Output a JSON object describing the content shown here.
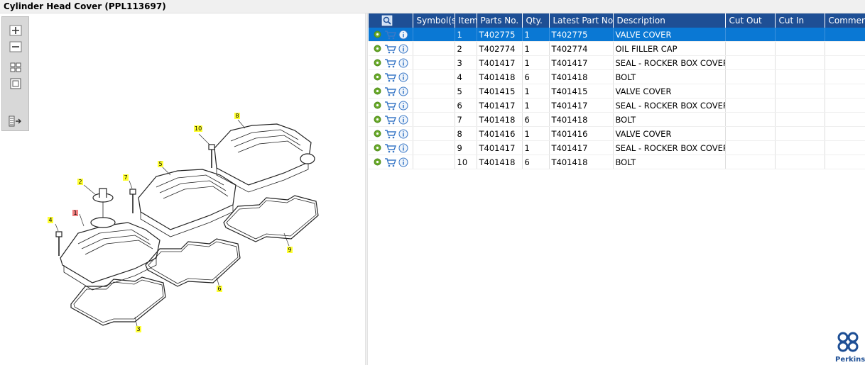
{
  "title": "Cylinder Head Cover (PPL113697)",
  "toolbar": {
    "zoom_in": "zoom-in-icon",
    "zoom_out": "zoom-out-icon",
    "fit": "fit-page-icon",
    "actual": "actual-size-icon",
    "layout": "toggle-layout-icon"
  },
  "callouts": [
    "1",
    "2",
    "3",
    "4",
    "5",
    "6",
    "7",
    "8",
    "9",
    "10"
  ],
  "grid": {
    "columns": [
      "Symbol(s)",
      "Item",
      "Parts No.",
      "Qty.",
      "Latest Part No.",
      "Description",
      "Cut Out",
      "Cut In",
      "Comment"
    ],
    "rows": [
      {
        "item": "1",
        "part": "T402775",
        "qty": "1",
        "latest": "T402775",
        "desc": "VALVE COVER"
      },
      {
        "item": "2",
        "part": "T402774",
        "qty": "1",
        "latest": "T402774",
        "desc": "OIL FILLER CAP"
      },
      {
        "item": "3",
        "part": "T401417",
        "qty": "1",
        "latest": "T401417",
        "desc": "SEAL - ROCKER BOX COVER"
      },
      {
        "item": "4",
        "part": "T401418",
        "qty": "6",
        "latest": "T401418",
        "desc": "BOLT"
      },
      {
        "item": "5",
        "part": "T401415",
        "qty": "1",
        "latest": "T401415",
        "desc": "VALVE COVER"
      },
      {
        "item": "6",
        "part": "T401417",
        "qty": "1",
        "latest": "T401417",
        "desc": "SEAL - ROCKER BOX COVER"
      },
      {
        "item": "7",
        "part": "T401418",
        "qty": "6",
        "latest": "T401418",
        "desc": "BOLT"
      },
      {
        "item": "8",
        "part": "T401416",
        "qty": "1",
        "latest": "T401416",
        "desc": "VALVE COVER"
      },
      {
        "item": "9",
        "part": "T401417",
        "qty": "1",
        "latest": "T401417",
        "desc": "SEAL - ROCKER BOX COVER"
      },
      {
        "item": "10",
        "part": "T401418",
        "qty": "6",
        "latest": "T401418",
        "desc": "BOLT"
      }
    ]
  },
  "brand": {
    "name": "Perkins",
    "color": "#1e4f95"
  },
  "colors": {
    "header": "#1e4f95",
    "selected": "#0a78d4",
    "callout": "#ffff33",
    "callout_selected": "#f08080"
  }
}
